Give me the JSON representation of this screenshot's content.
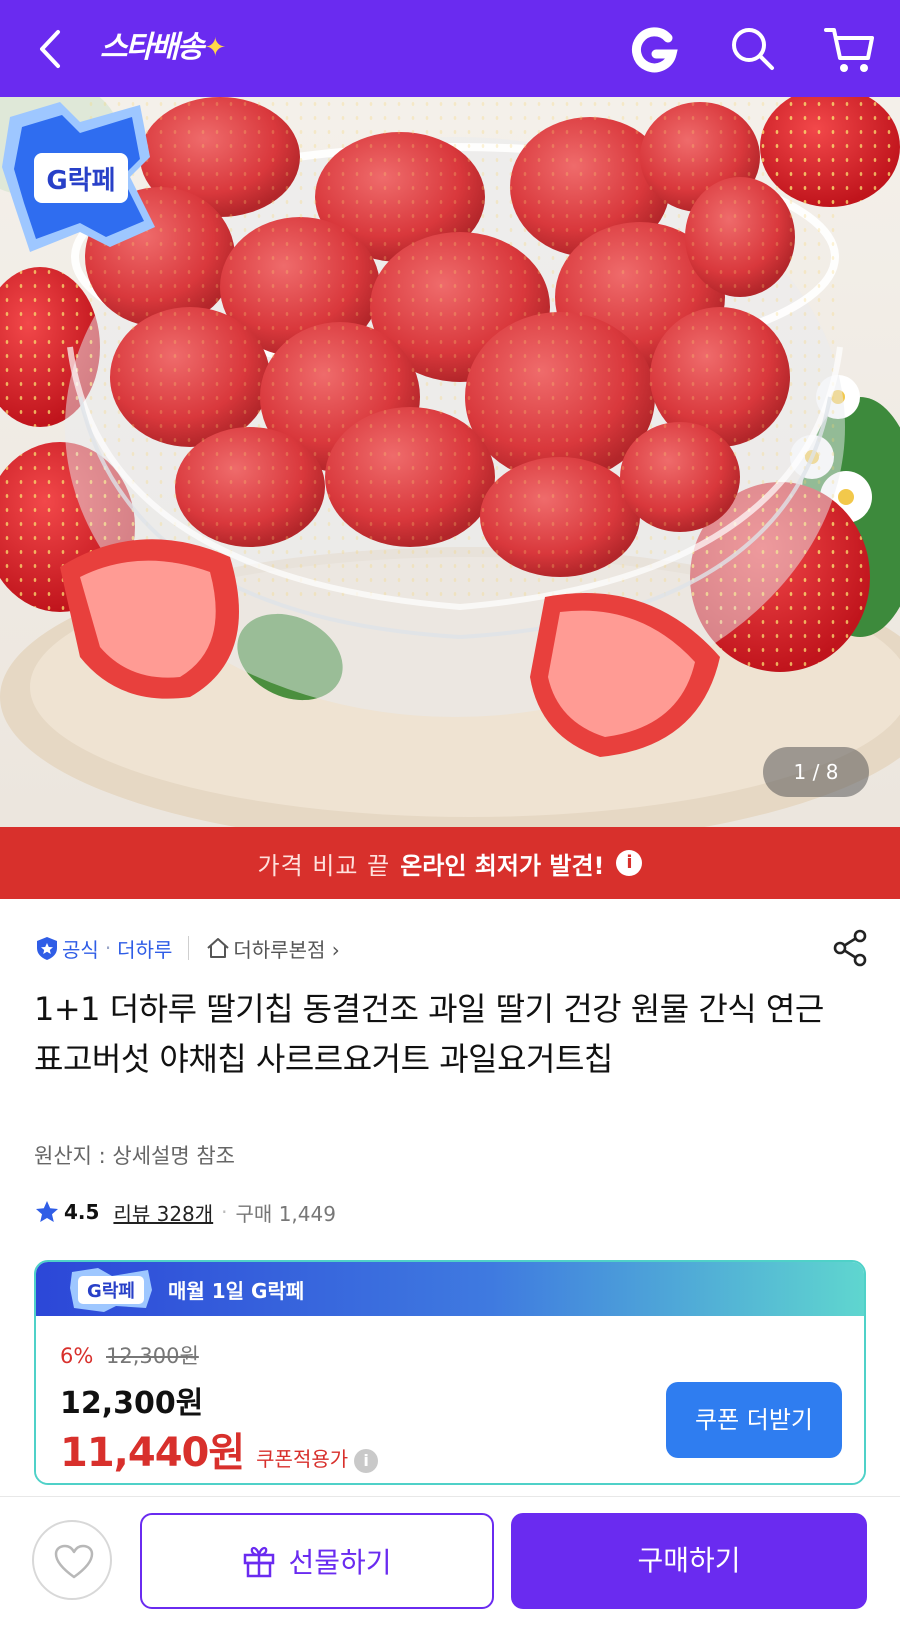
{
  "header": {
    "brand": "스타배송",
    "brand_spark": "✦"
  },
  "hero": {
    "counter": "1 / 8",
    "badge_text": "G락페"
  },
  "banner": {
    "light_text": "가격 비교 끝",
    "bold_text": "온라인 최저가 발견!",
    "info": "i"
  },
  "seller": {
    "official": "공식",
    "dot": "·",
    "brand": "더하루",
    "store": "더하루본점",
    "store_chevron": "›"
  },
  "product": {
    "title": "1+1 더하루 딸기칩 동결건조 과일 딸기 건강 원물 간식 연근 표고버섯 야채칩 사르르요거트 과일요거트칩",
    "origin": "원산지 : 상세설명 참조",
    "rating": "4.5",
    "reviews": "리뷰 328개",
    "buy_count": "구매 1,449"
  },
  "price_card": {
    "badge_text": "G락페",
    "header": "매월 1일 G락페",
    "discount": "6%",
    "original": "12,300원",
    "sale": "12,300원",
    "coupon_price": "11,440원",
    "coupon_label": "쿠폰적용가",
    "info": "i",
    "coupon_button": "쿠폰 더받기"
  },
  "bottom": {
    "gift": "선물하기",
    "buy": "구매하기"
  },
  "colors": {
    "brand_purple": "#6a2bf0",
    "banner_red": "#d8302c",
    "link_blue": "#2f5de6",
    "coupon_blue": "#2f7df0"
  },
  "icons": [
    "back-arrow-icon",
    "g-logo-icon",
    "search-icon",
    "cart-icon",
    "shield-icon",
    "home-icon",
    "share-icon",
    "star-icon",
    "heart-icon",
    "gift-icon",
    "info-icon"
  ]
}
